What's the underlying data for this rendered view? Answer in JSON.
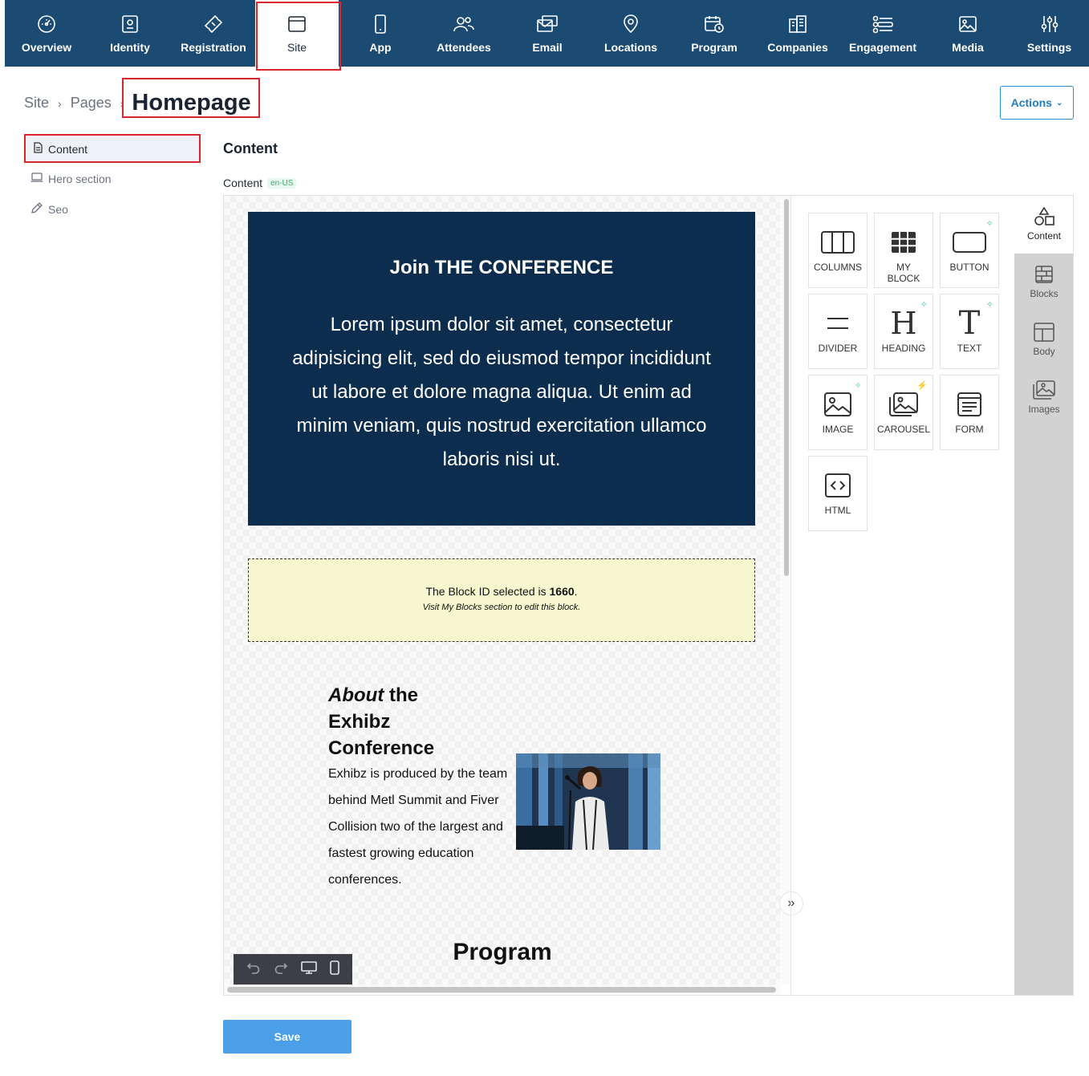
{
  "nav": {
    "items": [
      {
        "label": "Overview",
        "icon": "dashboard-icon"
      },
      {
        "label": "Identity",
        "icon": "id-card-icon"
      },
      {
        "label": "Registration",
        "icon": "ticket-icon"
      },
      {
        "label": "Site",
        "icon": "browser-window-icon",
        "active": true
      },
      {
        "label": "App",
        "icon": "mobile-phone-icon"
      },
      {
        "label": "Attendees",
        "icon": "users-icon"
      },
      {
        "label": "Email",
        "icon": "email-icon"
      },
      {
        "label": "Locations",
        "icon": "map-pin-icon"
      },
      {
        "label": "Program",
        "icon": "calendar-clock-icon"
      },
      {
        "label": "Companies",
        "icon": "building-icon"
      },
      {
        "label": "Engagement",
        "icon": "engagement-icon"
      },
      {
        "label": "Media",
        "icon": "image-icon"
      },
      {
        "label": "Settings",
        "icon": "sliders-icon"
      }
    ]
  },
  "breadcrumb": {
    "site": "Site",
    "pages": "Pages",
    "current": "Homepage"
  },
  "actions_label": "Actions",
  "sidebar": {
    "items": [
      {
        "label": "Content",
        "icon": "document-icon",
        "active": true
      },
      {
        "label": "Hero section",
        "icon": "laptop-icon"
      },
      {
        "label": "Seo",
        "icon": "pencil-icon"
      }
    ]
  },
  "section_title": "Content",
  "content_field": {
    "label": "Content",
    "locale": "en-US"
  },
  "canvas": {
    "hero": {
      "title": "Join THE CONFERENCE",
      "body": "Lorem ipsum dolor sit amet, consectetur adipisicing elit, sed do eiusmod tempor incididunt ut labore et dolore magna aliqua. Ut enim ad minim veniam, quis nostrud exercitation ullamco laboris nisi ut."
    },
    "block_notice": {
      "prefix": "The Block ID selected is ",
      "block_id": "1660",
      "suffix": ".",
      "sub": "Visit My Blocks section to edit this block."
    },
    "about": {
      "title_italic": "About",
      "title_rest": " the Exhibz Conference",
      "body": "Exhibz is produced by the team behind Metl Summit and Fiver Collision two of the largest and fastest growing education conferences."
    },
    "program_title": "Program"
  },
  "blocks": [
    {
      "label": "COLUMNS",
      "icon": "columns-icon"
    },
    {
      "label": "MY BLOCK",
      "icon": "grid-block-icon"
    },
    {
      "label": "BUTTON",
      "icon": "button-icon",
      "badge": "sparkle"
    },
    {
      "label": "DIVIDER",
      "icon": "divider-icon"
    },
    {
      "label": "HEADING",
      "icon": "heading-icon",
      "badge": "sparkle"
    },
    {
      "label": "TEXT",
      "icon": "text-icon",
      "badge": "sparkle"
    },
    {
      "label": "IMAGE",
      "icon": "image-icon",
      "badge": "sparkle"
    },
    {
      "label": "CAROUSEL",
      "icon": "carousel-icon",
      "badge": "bolt"
    },
    {
      "label": "FORM",
      "icon": "form-icon"
    },
    {
      "label": "HTML",
      "icon": "code-icon"
    }
  ],
  "side_tabs": [
    {
      "label": "Content",
      "icon": "shapes-icon",
      "active": true
    },
    {
      "label": "Blocks",
      "icon": "bricks-icon"
    },
    {
      "label": "Body",
      "icon": "layout-icon"
    },
    {
      "label": "Images",
      "icon": "images-icon"
    }
  ],
  "save_label": "Save",
  "colors": {
    "nav_bg": "#1b4a72",
    "hero_bg": "#0c2d4d",
    "notice_bg": "#f7f7cf",
    "accent": "#2b8fd6",
    "save_bg": "#4a9fe8",
    "highlight": "#d9262c"
  }
}
